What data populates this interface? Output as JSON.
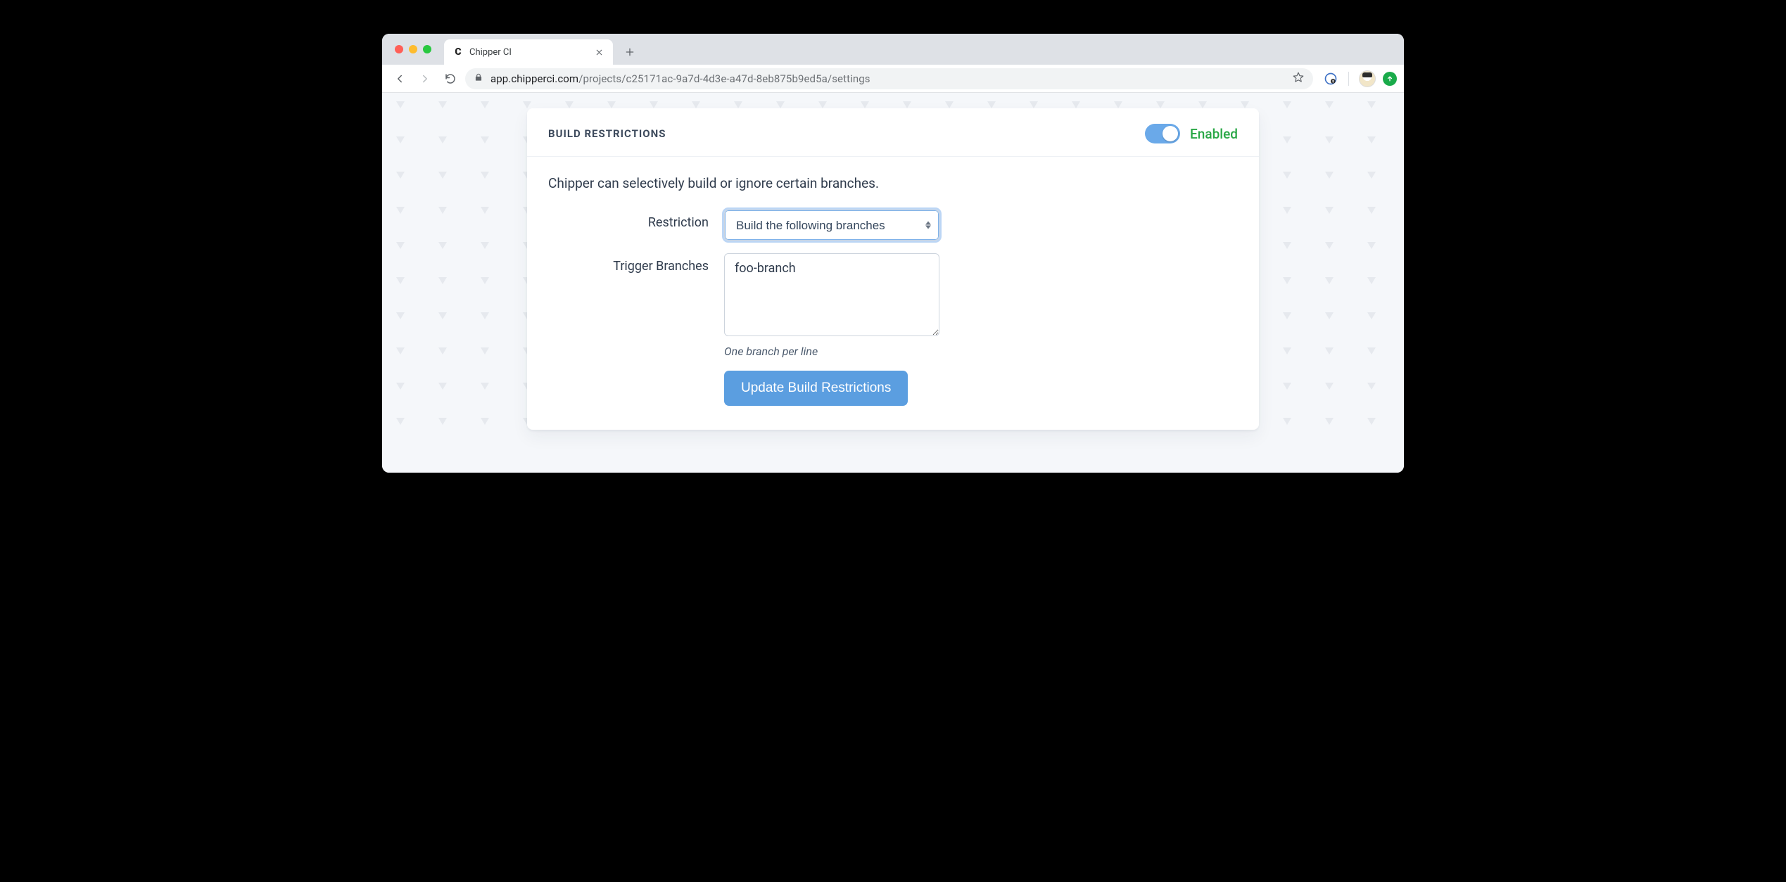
{
  "browser": {
    "tab_title": "Chipper CI",
    "url_host": "app.chipperci.com",
    "url_path": "/projects/c25171ac-9a7d-4d3e-a47d-8eb875b9ed5a/settings"
  },
  "card": {
    "title": "Build Restrictions",
    "toggle_label": "Enabled",
    "intro": "Chipper can selectively build or ignore certain branches.",
    "restriction_label": "Restriction",
    "restriction_value": "Build the following branches",
    "branches_label": "Trigger Branches",
    "branches_value": "foo-branch",
    "branches_hint": "One branch per line",
    "submit_label": "Update Build Restrictions"
  }
}
